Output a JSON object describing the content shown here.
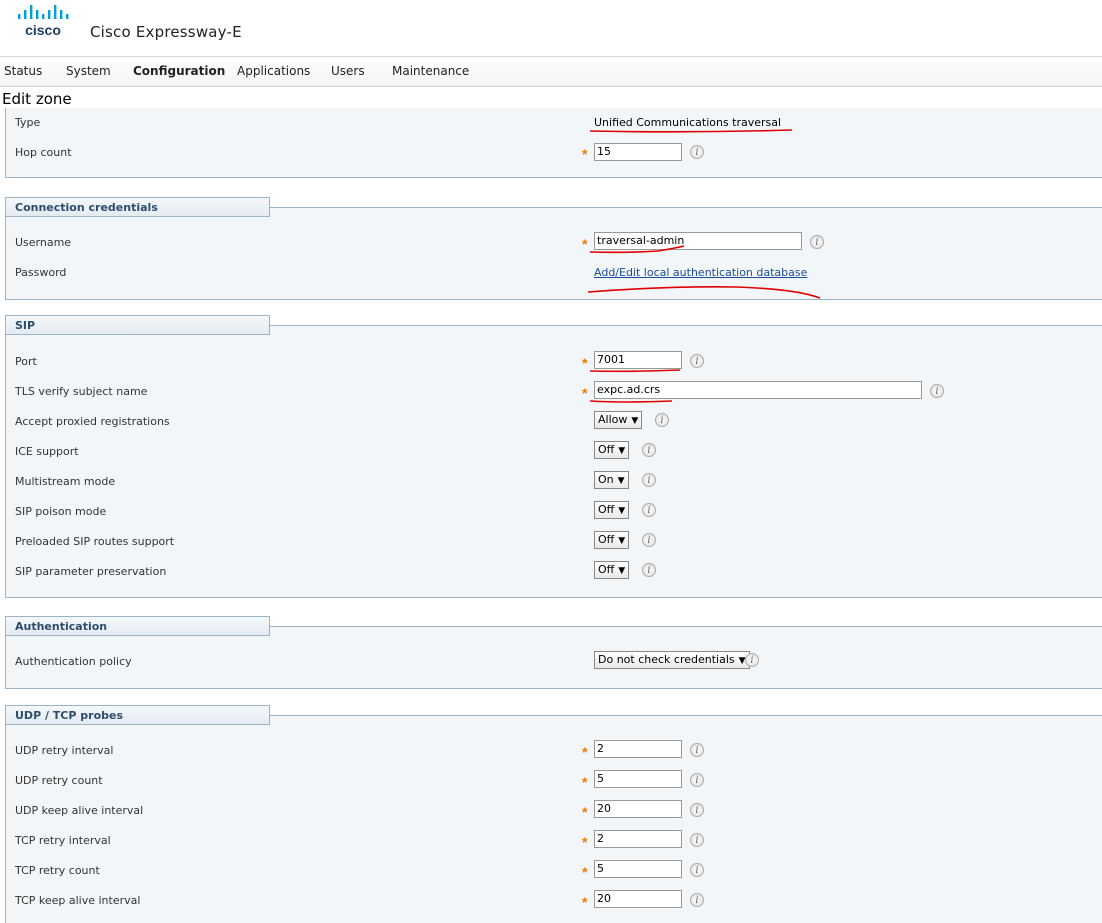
{
  "app": {
    "brand": "cisco",
    "product": "Cisco Expressway-E"
  },
  "nav": [
    {
      "label": "Status"
    },
    {
      "label": "System"
    },
    {
      "label": "Configuration",
      "active": true
    },
    {
      "label": "Applications"
    },
    {
      "label": "Users"
    },
    {
      "label": "Maintenance"
    }
  ],
  "page": {
    "title": "Edit zone"
  },
  "top": {
    "type_label": "Type",
    "type_value": "Unified Communications traversal",
    "hop_label": "Hop count",
    "hop_value": "15"
  },
  "credentials": {
    "title": "Connection credentials",
    "username_label": "Username",
    "username_value": "traversal-admin",
    "password_label": "Password",
    "password_link": "Add/Edit local authentication database"
  },
  "sip": {
    "title": "SIP",
    "port_label": "Port",
    "port_value": "7001",
    "tls_label": "TLS verify subject name",
    "tls_value": "expc.ad.crs",
    "proxied_label": "Accept proxied registrations",
    "proxied_value": "Allow",
    "ice_label": "ICE support",
    "ice_value": "Off",
    "multistream_label": "Multistream mode",
    "multistream_value": "On",
    "poison_label": "SIP poison mode",
    "poison_value": "Off",
    "preloaded_label": "Preloaded SIP routes support",
    "preloaded_value": "Off",
    "param_label": "SIP parameter preservation",
    "param_value": "Off"
  },
  "auth": {
    "title": "Authentication",
    "policy_label": "Authentication policy",
    "policy_value": "Do not check credentials"
  },
  "probes": {
    "title": "UDP / TCP probes",
    "udp_retry_interval_label": "UDP retry interval",
    "udp_retry_interval_value": "2",
    "udp_retry_count_label": "UDP retry count",
    "udp_retry_count_value": "5",
    "udp_keepalive_label": "UDP keep alive interval",
    "udp_keepalive_value": "20",
    "tcp_retry_interval_label": "TCP retry interval",
    "tcp_retry_interval_value": "2",
    "tcp_retry_count_label": "TCP retry count",
    "tcp_retry_count_value": "5",
    "tcp_keepalive_label": "TCP keep alive interval",
    "tcp_keepalive_value": "20"
  },
  "colors": {
    "required": "#f07c00",
    "section_border": "#9bb3c7",
    "section_title": "#2d4d6d",
    "annotation": "#e00000"
  },
  "icons": {
    "info": "info-icon",
    "dropdown": "chevron-down-icon"
  },
  "info_glyph": "i",
  "required_glyph": "*",
  "dropdown_glyph": "▼"
}
